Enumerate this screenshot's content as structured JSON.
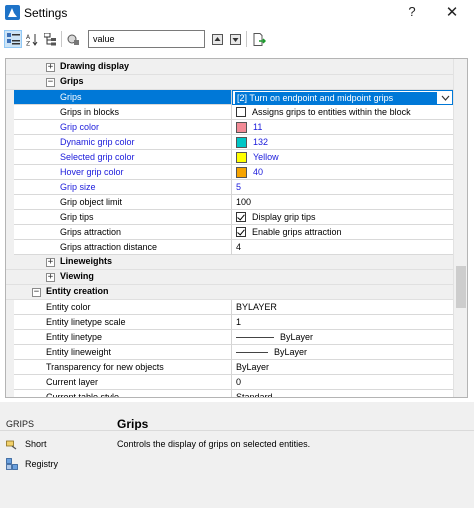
{
  "window": {
    "title": "Settings",
    "help_glyph": "?",
    "close_glyph": "✕"
  },
  "toolbar": {
    "search_value": "value"
  },
  "categories": {
    "drawing_display": "Drawing display",
    "grips": "Grips",
    "lineweights": "Lineweights",
    "viewing": "Viewing",
    "entity_creation": "Entity creation"
  },
  "grips_rows": [
    {
      "name": "Grips",
      "value": "[2] Turn on endpoint and midpoint grips"
    },
    {
      "name": "Grips in blocks",
      "value": "Assigns grips to entities within the block",
      "checked": false
    },
    {
      "name": "Grip color",
      "value": "11",
      "color": "#f28b96"
    },
    {
      "name": "Dynamic grip color",
      "value": "132",
      "color": "#00c6c6"
    },
    {
      "name": "Selected grip color",
      "value": "Yellow",
      "color": "#ffff00"
    },
    {
      "name": "Hover grip color",
      "value": "40",
      "color": "#f7a400"
    },
    {
      "name": "Grip size",
      "value": "5"
    },
    {
      "name": "Grip object limit",
      "value": "100"
    },
    {
      "name": "Grip tips",
      "value": "Display grip tips",
      "checked": true
    },
    {
      "name": "Grips attraction",
      "value": "Enable grips attraction",
      "checked": true
    },
    {
      "name": "Grips attraction distance",
      "value": "4"
    }
  ],
  "entity_rows": [
    {
      "name": "Entity color",
      "value": "BYLAYER"
    },
    {
      "name": "Entity linetype scale",
      "value": "1"
    },
    {
      "name": "Entity linetype",
      "value": "ByLayer"
    },
    {
      "name": "Entity lineweight",
      "value": "ByLayer"
    },
    {
      "name": "Transparency for new objects",
      "value": "ByLayer"
    },
    {
      "name": "Current layer",
      "value": "0"
    },
    {
      "name": "Current table style",
      "value": "Standard"
    }
  ],
  "description": {
    "variable": "GRIPS",
    "short_label": "Short",
    "registry_label": "Registry",
    "title": "Grips",
    "text": "Controls the display of grips on selected entities."
  },
  "colors": {
    "selection": "#0078d7",
    "modified_text": "#1a1adb"
  }
}
